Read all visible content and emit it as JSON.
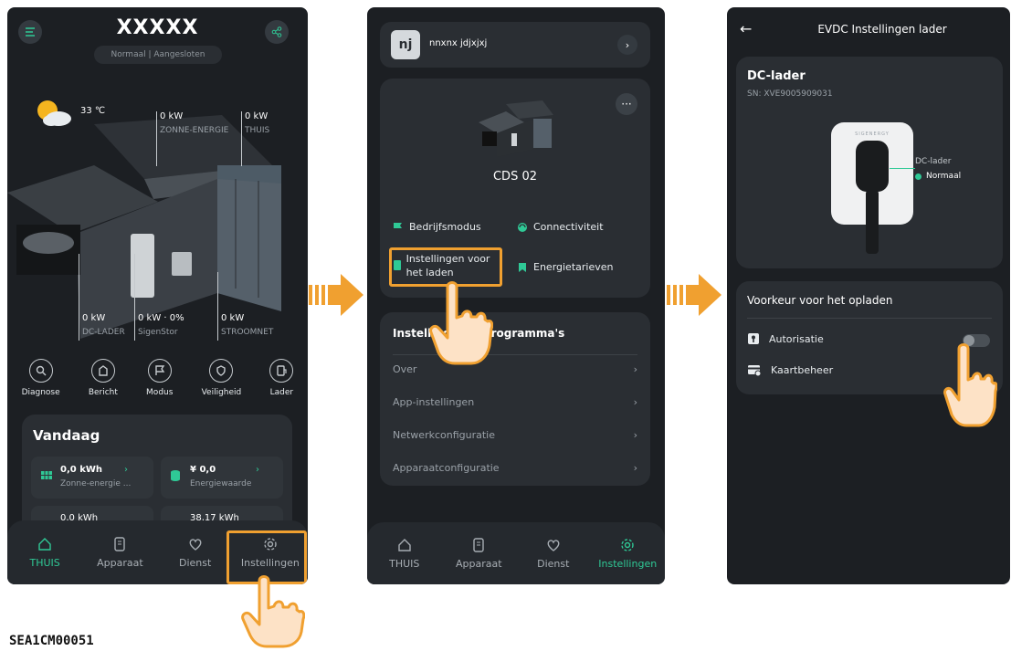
{
  "screen1": {
    "title": "XXXXX",
    "status": "Normaal | Aangesloten",
    "temperature": "33 ℃",
    "labels": [
      {
        "value": "0 kW",
        "sub": "ZONNE-ENERGIE"
      },
      {
        "value": "0 kW",
        "sub": "THUIS"
      },
      {
        "value": "0 kW",
        "sub": "DC-LADER"
      },
      {
        "value": "0 kW · 0%",
        "sub": "SigenStor"
      },
      {
        "value": "0 kW",
        "sub": "STROOMNET"
      }
    ],
    "quick_actions": [
      "Diagnose",
      "Bericht",
      "Modus",
      "Veiligheid",
      "Lader"
    ],
    "today": {
      "title": "Vandaag",
      "tiles": [
        {
          "value": "0,0 kWh",
          "label": "Zonne-energie ..."
        },
        {
          "value": "¥ 0,0",
          "label": "Energiewaarde"
        },
        {
          "value": "0,0 kWh",
          "label": ""
        },
        {
          "value": "38,17 kWh",
          "label": ""
        }
      ]
    },
    "nav": [
      "THUIS",
      "Apparaat",
      "Dienst",
      "Instellingen"
    ]
  },
  "screen2": {
    "avatar": "nj",
    "user_name": "nnxnx jdjxjxj",
    "device_name": "CDS 02",
    "functions": [
      "Bedrijfsmodus",
      "Connectiviteit",
      "Instellingen voor het laden",
      "Energietarieven"
    ],
    "program_title": "Instellingen & programma's",
    "program_items": [
      "Over",
      "App-instellingen",
      "Netwerkconfiguratie",
      "Apparaatconfiguratie"
    ],
    "nav": [
      "THUIS",
      "Apparaat",
      "Dienst",
      "Instellingen"
    ]
  },
  "screen3": {
    "header_title": "EVDC Instellingen lader",
    "charger_title": "DC-lader",
    "serial": "SN: XVE9005909031",
    "device_label": "DC-lader",
    "device_status": "Normaal",
    "brand": "SIGENERGY",
    "pref_title": "Voorkeur voor het opladen",
    "rows": [
      "Autorisatie",
      "Kaartbeheer"
    ]
  },
  "footer_code": "SEA1CM00051",
  "colors": {
    "accent": "#2fc996",
    "highlight": "#f0a030",
    "bg": "#1c1f23",
    "card": "#2a2e33"
  }
}
